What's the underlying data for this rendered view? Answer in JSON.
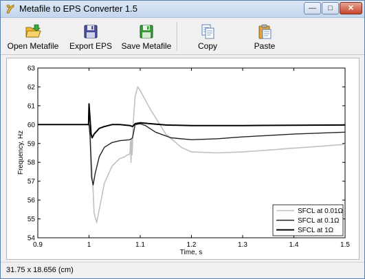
{
  "window": {
    "title": "Metafile to EPS Converter 1.5",
    "buttons": {
      "minimize": "—",
      "maximize": "□",
      "close": "✕"
    }
  },
  "toolbar": {
    "open_metafile": "Open Metafile",
    "export_eps": "Export EPS",
    "save_metafile": "Save Metafile",
    "copy": "Copy",
    "paste": "Paste"
  },
  "status": {
    "dimensions": "31.75 x 18.656 (cm)"
  },
  "chart_data": {
    "type": "line",
    "xlabel": "Time, s",
    "ylabel": "Frequency, Hz",
    "xlim": [
      0.9,
      1.5
    ],
    "ylim": [
      54,
      63
    ],
    "xticks": [
      "0.9",
      "1",
      "1.1",
      "1.2",
      "1.3",
      "1.4",
      "1.5"
    ],
    "yticks": [
      "54",
      "55",
      "56",
      "57",
      "58",
      "59",
      "60",
      "61",
      "62",
      "63"
    ],
    "legend_position": "bottom-right",
    "series": [
      {
        "name": "SFCL at 0.01Ω",
        "color": "#c0c0c0",
        "x": [
          0.9,
          1.0,
          1.002,
          1.005,
          1.008,
          1.01,
          1.015,
          1.02,
          1.03,
          1.045,
          1.06,
          1.07,
          1.075,
          1.078,
          1.08,
          1.081,
          1.082,
          1.083,
          1.084,
          1.085,
          1.086,
          1.09,
          1.095,
          1.1,
          1.12,
          1.15,
          1.18,
          1.2,
          1.25,
          1.3,
          1.35,
          1.4,
          1.45,
          1.5
        ],
        "y": [
          60.0,
          60.0,
          59.6,
          58.0,
          56.5,
          55.3,
          54.8,
          55.5,
          56.9,
          57.8,
          58.2,
          58.3,
          58.4,
          58.4,
          58.5,
          59.1,
          58.0,
          59.2,
          58.4,
          58.9,
          60.0,
          61.5,
          62.0,
          61.8,
          60.8,
          59.5,
          58.8,
          58.55,
          58.5,
          58.55,
          58.65,
          58.75,
          58.85,
          58.95
        ]
      },
      {
        "name": "SFCL at 0.1Ω",
        "color": "#202020",
        "x": [
          0.9,
          1.0,
          1.002,
          1.005,
          1.008,
          1.012,
          1.02,
          1.03,
          1.045,
          1.06,
          1.08,
          1.085,
          1.09,
          1.1,
          1.11,
          1.13,
          1.16,
          1.2,
          1.25,
          1.3,
          1.4,
          1.5
        ],
        "y": [
          60.0,
          60.0,
          59.4,
          57.2,
          56.8,
          57.4,
          58.3,
          58.8,
          59.05,
          59.15,
          59.2,
          59.3,
          60.0,
          60.05,
          59.95,
          59.6,
          59.3,
          59.2,
          59.25,
          59.35,
          59.5,
          59.6
        ]
      },
      {
        "name": "SFCL at 1Ω",
        "color": "#000000",
        "x": [
          0.9,
          0.999,
          1.0,
          1.002,
          1.004,
          1.006,
          1.01,
          1.02,
          1.03,
          1.045,
          1.06,
          1.08,
          1.085,
          1.09,
          1.1,
          1.12,
          1.15,
          1.2,
          1.3,
          1.4,
          1.5
        ],
        "y": [
          60.0,
          60.0,
          61.1,
          60.3,
          59.5,
          59.3,
          59.5,
          59.8,
          59.9,
          60.0,
          60.0,
          59.95,
          59.9,
          60.05,
          60.1,
          60.05,
          59.98,
          59.95,
          59.95,
          59.97,
          59.98
        ]
      }
    ]
  },
  "colors": {
    "titlebar": "#c4d6ec",
    "window_bg": "#f0f0f0",
    "open_icon": "#f1b82f",
    "export_icon": "#4a4fa0",
    "save_icon": "#3a9a3a"
  }
}
